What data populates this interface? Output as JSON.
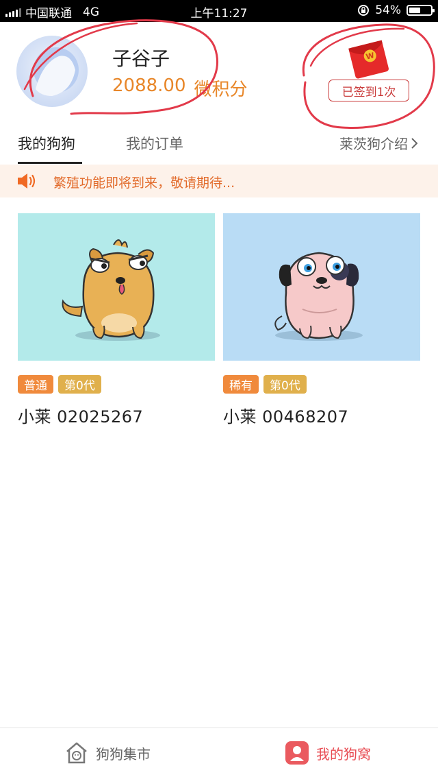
{
  "status_bar": {
    "carrier": "中国联通",
    "network": "4G",
    "time": "上午11:27",
    "battery_percent": "54%",
    "battery_level": 0.54
  },
  "header": {
    "username": "子谷子",
    "points_value": "2088.00",
    "points_unit": "微积分",
    "checkin_label": "已签到1次",
    "redpacket_icon": "red-envelope-icon"
  },
  "tabs": [
    {
      "label": "我的狗狗",
      "active": true
    },
    {
      "label": "我的订单",
      "active": false
    }
  ],
  "intro_link": "莱茨狗介绍",
  "notice": {
    "icon": "speaker-icon",
    "text": "繁殖功能即将到来，敬请期待..."
  },
  "dogs": [
    {
      "rarity": "普通",
      "generation": "第0代",
      "name": "小莱 02025267",
      "bg_color": "#b3eaea"
    },
    {
      "rarity": "稀有",
      "generation": "第0代",
      "name": "小莱 00468207",
      "bg_color": "#b9dcf5"
    }
  ],
  "bottom_nav": [
    {
      "label": "狗狗集市",
      "icon": "dog-house-icon",
      "active": false
    },
    {
      "label": "我的狗窝",
      "icon": "kennel-icon",
      "active": true
    }
  ],
  "colors": {
    "accent_orange": "#e8872a",
    "checkin_red": "#c93a3a",
    "nav_active": "#e84b52",
    "rarity_tag": "#f08a3c",
    "generation_tag": "#e0b04c"
  }
}
